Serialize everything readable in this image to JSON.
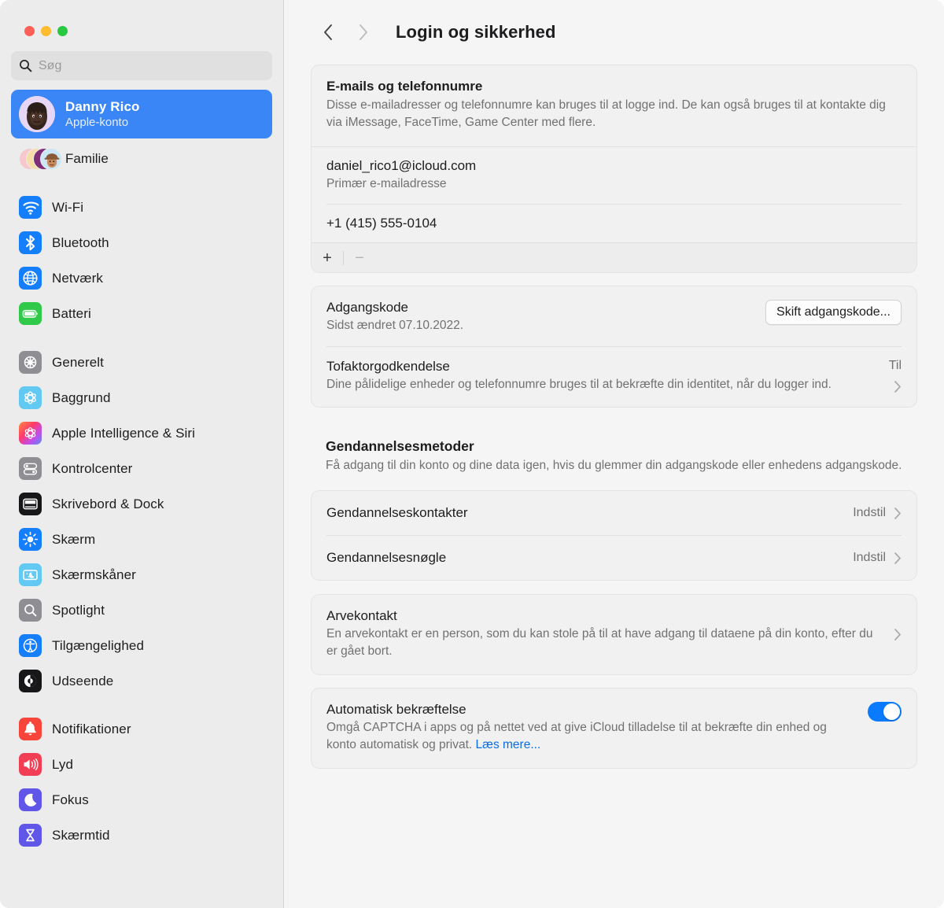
{
  "window": {
    "traffic_lights": [
      "close",
      "minimize",
      "zoom"
    ],
    "colors": {
      "close": "#FF5F57",
      "minimize": "#FEBC2E",
      "zoom": "#28C840",
      "accent": "#0A7AFF",
      "selection": "#3A86F7",
      "link": "#0A6CE0"
    }
  },
  "sidebar": {
    "search": {
      "placeholder": "Søg",
      "value": "",
      "icon": "search-icon"
    },
    "account": {
      "name": "Danny Rico",
      "subtitle": "Apple-konto",
      "avatar": "memoji-avatar"
    },
    "family": {
      "label": "Familie",
      "icon": "family-avatars"
    },
    "groups": [
      {
        "items": [
          {
            "label": "Wi-Fi",
            "icon": "wifi-icon"
          },
          {
            "label": "Bluetooth",
            "icon": "bluetooth-icon"
          },
          {
            "label": "Netværk",
            "icon": "network-globe-icon"
          },
          {
            "label": "Batteri",
            "icon": "battery-icon"
          }
        ]
      },
      {
        "items": [
          {
            "label": "Generelt",
            "icon": "gear-icon"
          },
          {
            "label": "Baggrund",
            "icon": "wallpaper-icon"
          },
          {
            "label": "Apple Intelligence & Siri",
            "icon": "apple-intelligence-icon"
          },
          {
            "label": "Kontrolcenter",
            "icon": "control-center-icon"
          },
          {
            "label": "Skrivebord & Dock",
            "icon": "desktop-dock-icon"
          },
          {
            "label": "Skærm",
            "icon": "display-brightness-icon"
          },
          {
            "label": "Skærmskåner",
            "icon": "screensaver-icon"
          },
          {
            "label": "Spotlight",
            "icon": "spotlight-search-icon"
          },
          {
            "label": "Tilgængelighed",
            "icon": "accessibility-icon"
          },
          {
            "label": "Udseende",
            "icon": "appearance-icon"
          }
        ]
      },
      {
        "items": [
          {
            "label": "Notifikationer",
            "icon": "notifications-bell-icon"
          },
          {
            "label": "Lyd",
            "icon": "sound-speaker-icon"
          },
          {
            "label": "Fokus",
            "icon": "focus-moon-icon"
          },
          {
            "label": "Skærmtid",
            "icon": "screen-time-hourglass-icon"
          }
        ]
      }
    ]
  },
  "main": {
    "nav": {
      "back": "back-chevron",
      "forward": "forward-chevron"
    },
    "title": "Login og sikkerhed",
    "emails_card": {
      "title": "E-mails og telefonnumre",
      "description": "Disse e-mailadresser og telefonnumre kan bruges til at logge ind. De kan også bruges til at kontakte dig via iMessage, FaceTime, Game Center med flere.",
      "entries": [
        {
          "value": "daniel_rico1@icloud.com",
          "sub": "Primær e-mailadresse"
        },
        {
          "value": "+1 (415) 555-0104",
          "sub": ""
        }
      ],
      "add_label": "+",
      "remove_label": "−"
    },
    "password_card": {
      "password_title": "Adgangskode",
      "password_sub": "Sidst ændret 07.10.2022.",
      "change_button": "Skift adgangskode...",
      "twofactor_title": "Tofaktorgodkendelse",
      "twofactor_sub": "Dine pålidelige enheder og telefonnumre bruges til at bekræfte din identitet, når du logger ind.",
      "twofactor_value": "Til"
    },
    "recovery": {
      "title": "Gendannelsesmetoder",
      "description": "Få adgang til din konto og dine data igen, hvis du glemmer din adgangskode eller enhedens adgangskode.",
      "rows": [
        {
          "title": "Gendannelseskontakter",
          "value": "Indstil"
        },
        {
          "title": "Gendannelsesnøgle",
          "value": "Indstil"
        }
      ]
    },
    "legacy_card": {
      "title": "Arvekontakt",
      "description": "En arvekontakt er en person, som du kan stole på til at have adgang til dataene på din konto, efter du er gået bort."
    },
    "autoverify_card": {
      "title": "Automatisk bekræftelse",
      "description_before": "Omgå CAPTCHA i apps og på nettet ved at give iCloud tilladelse til at bekræfte din enhed og konto automatisk og privat. ",
      "link_label": "Læs mere...",
      "toggle_state": "on"
    }
  }
}
